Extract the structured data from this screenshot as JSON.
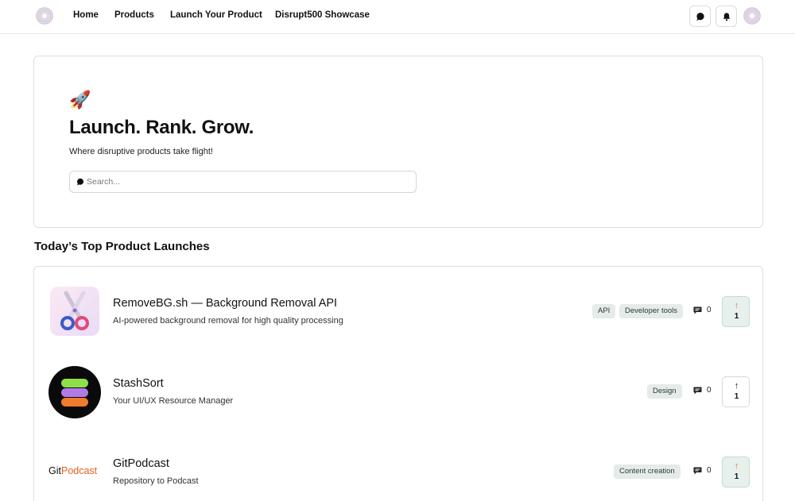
{
  "nav": {
    "items": [
      "Home",
      "Products",
      "Launch Your Product",
      "Disrupt500 Showcase"
    ]
  },
  "header": {
    "icons": [
      "chat-icon",
      "bell-icon"
    ]
  },
  "hero": {
    "emoji": "🚀",
    "title": "Launch. Rank. Grow.",
    "subtitle": "Where disruptive products take flight!",
    "search_placeholder": "Search..."
  },
  "section": {
    "title": "Today’s Top Product Launches"
  },
  "products": [
    {
      "name": "RemoveBG.sh — Background Removal API",
      "description": "AI-powered background removal for high quality processing",
      "tags": [
        "API",
        "Developer tools"
      ],
      "comments": "0",
      "votes": "1",
      "voted": true
    },
    {
      "name": "StashSort",
      "description": "Your UI/UX Resource Manager",
      "tags": [
        "Design"
      ],
      "comments": "0",
      "votes": "1",
      "voted": false
    },
    {
      "name": "GitPodcast",
      "logo_text_1": "Git",
      "logo_text_2": "Podcast",
      "description": "Repository to Podcast",
      "tags": [
        "Content creation"
      ],
      "comments": "0",
      "votes": "1",
      "voted": true
    }
  ],
  "colors": {
    "accent_orange": "#e0621e",
    "tag_bg": "#e4ebe8",
    "voted_bg": "#e6f0ec"
  }
}
